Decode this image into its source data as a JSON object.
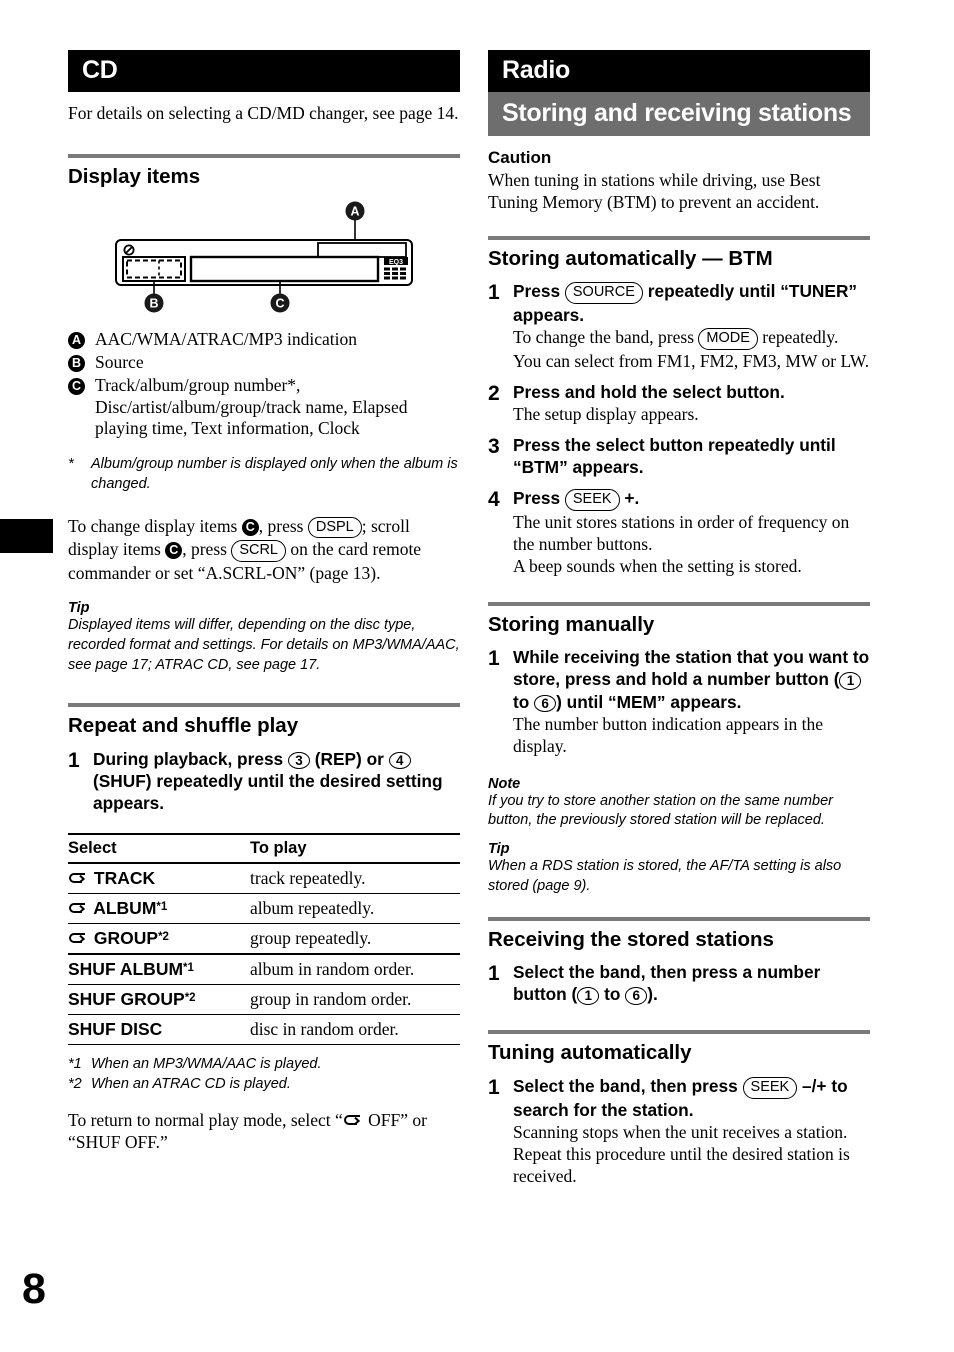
{
  "page": {
    "number": "8"
  },
  "left": {
    "chapter": "CD",
    "intro": "For details on selecting a CD/MD changer, see page 14.",
    "display_items": {
      "heading": "Display items",
      "figure": {
        "badge_a": "A",
        "badge_b": "B",
        "badge_c": "C",
        "eq_label": "EQ3"
      },
      "legend": [
        {
          "badge": "A",
          "text": "AAC/WMA/ATRAC/MP3 indication"
        },
        {
          "badge": "B",
          "text": "Source"
        },
        {
          "badge": "C",
          "text": "Track/album/group number*, Disc/artist/album/group/track name, Elapsed playing time, Text information, Clock"
        }
      ],
      "footnote_mark": "*",
      "footnote_text": "Album/group number is displayed only when the album is changed.",
      "change_para_1": "To change display items ",
      "change_para_2": ", press ",
      "key_dspl": "DSPL",
      "change_para_3": "; scroll display items ",
      "change_para_4": ", press ",
      "key_scrl": "SCRL",
      "change_para_5": " on the card remote commander or set “A.SCRL-ON” (page 13).",
      "tip_head": "Tip",
      "tip_text": "Displayed items will differ, depending on the disc type, recorded format and settings. For details on MP3/WMA/AAC, see page 17; ATRAC CD, see page 17."
    },
    "repeat_shuffle": {
      "heading": "Repeat and shuffle play",
      "step_num": "1",
      "step_a": "During playback, press ",
      "key_3": "3",
      "step_b": " (REP) or ",
      "key_4": "4",
      "step_c": " (SHUF) repeatedly until the desired setting appears.",
      "table": {
        "headers": [
          "Select",
          "To play"
        ],
        "rows": [
          {
            "icon": "repeat-loop",
            "select": "TRACK",
            "sup": "",
            "play": "track repeatedly."
          },
          {
            "icon": "repeat-loop",
            "select": "ALBUM",
            "sup": "*1",
            "play": "album repeatedly."
          },
          {
            "icon": "repeat-loop",
            "select": "GROUP",
            "sup": "*2",
            "play": "group repeatedly."
          },
          {
            "icon": "",
            "select": "SHUF ALBUM",
            "sup": "*1",
            "play": "album in random order."
          },
          {
            "icon": "",
            "select": "SHUF GROUP",
            "sup": "*2",
            "play": "group in random order."
          },
          {
            "icon": "",
            "select": "SHUF DISC",
            "sup": "",
            "play": "disc in random order."
          }
        ]
      },
      "footnotes": [
        {
          "mark": "*1",
          "text": "When an MP3/WMA/AAC is played."
        },
        {
          "mark": "*2",
          "text": "When an ATRAC CD is played."
        }
      ],
      "return_para_1": "To return to normal play mode, select “",
      "return_para_2": " OFF” or “SHUF OFF.”"
    }
  },
  "right": {
    "chapter": "Radio",
    "section": "Storing and receiving stations",
    "caution": {
      "heading": "Caution",
      "text": "When tuning in stations while driving, use Best Tuning Memory (BTM) to prevent an accident."
    },
    "btm": {
      "heading": "Storing automatically — BTM",
      "steps": [
        {
          "num": "1",
          "title_a": "Press ",
          "key": "SOURCE",
          "title_b": " repeatedly until “TUNER” appears.",
          "desc_a": "To change the band, press ",
          "desc_key": "MODE",
          "desc_b": " repeatedly. You can select from FM1, FM2, FM3, MW or LW."
        },
        {
          "num": "2",
          "title_a": "Press and hold the select button.",
          "desc_a": "The setup display appears."
        },
        {
          "num": "3",
          "title_a": "Press the select button repeatedly until “BTM” appears."
        },
        {
          "num": "4",
          "title_a": "Press ",
          "key": "SEEK",
          "title_b": " +.",
          "desc_a": "The unit stores stations in order of frequency on the number buttons.",
          "desc_b": "A beep sounds when the setting is stored."
        }
      ]
    },
    "manual": {
      "heading": "Storing manually",
      "step_num": "1",
      "title_a": "While receiving the station that you want to store, press and hold a number button (",
      "key_1": "1",
      "title_b": " to ",
      "key_6": "6",
      "title_c": ") until “MEM” appears.",
      "desc": "The number button indication appears in the display.",
      "note_head": "Note",
      "note_text": "If you try to store another station on the same number button, the previously stored station will be replaced.",
      "tip_head": "Tip",
      "tip_text": "When a RDS station is stored, the AF/TA setting is also stored (page 9)."
    },
    "receiving": {
      "heading": "Receiving the stored stations",
      "step_num": "1",
      "title_a": "Select the band, then press a number button (",
      "key_1": "1",
      "title_b": " to ",
      "key_6": "6",
      "title_c": ")."
    },
    "tuning": {
      "heading": "Tuning automatically",
      "step_num": "1",
      "title_a": "Select the band, then press ",
      "key": "SEEK",
      "title_b": " –/+ to search for the station.",
      "desc": "Scanning stops when the unit receives a station. Repeat this procedure until the desired station is received."
    }
  }
}
